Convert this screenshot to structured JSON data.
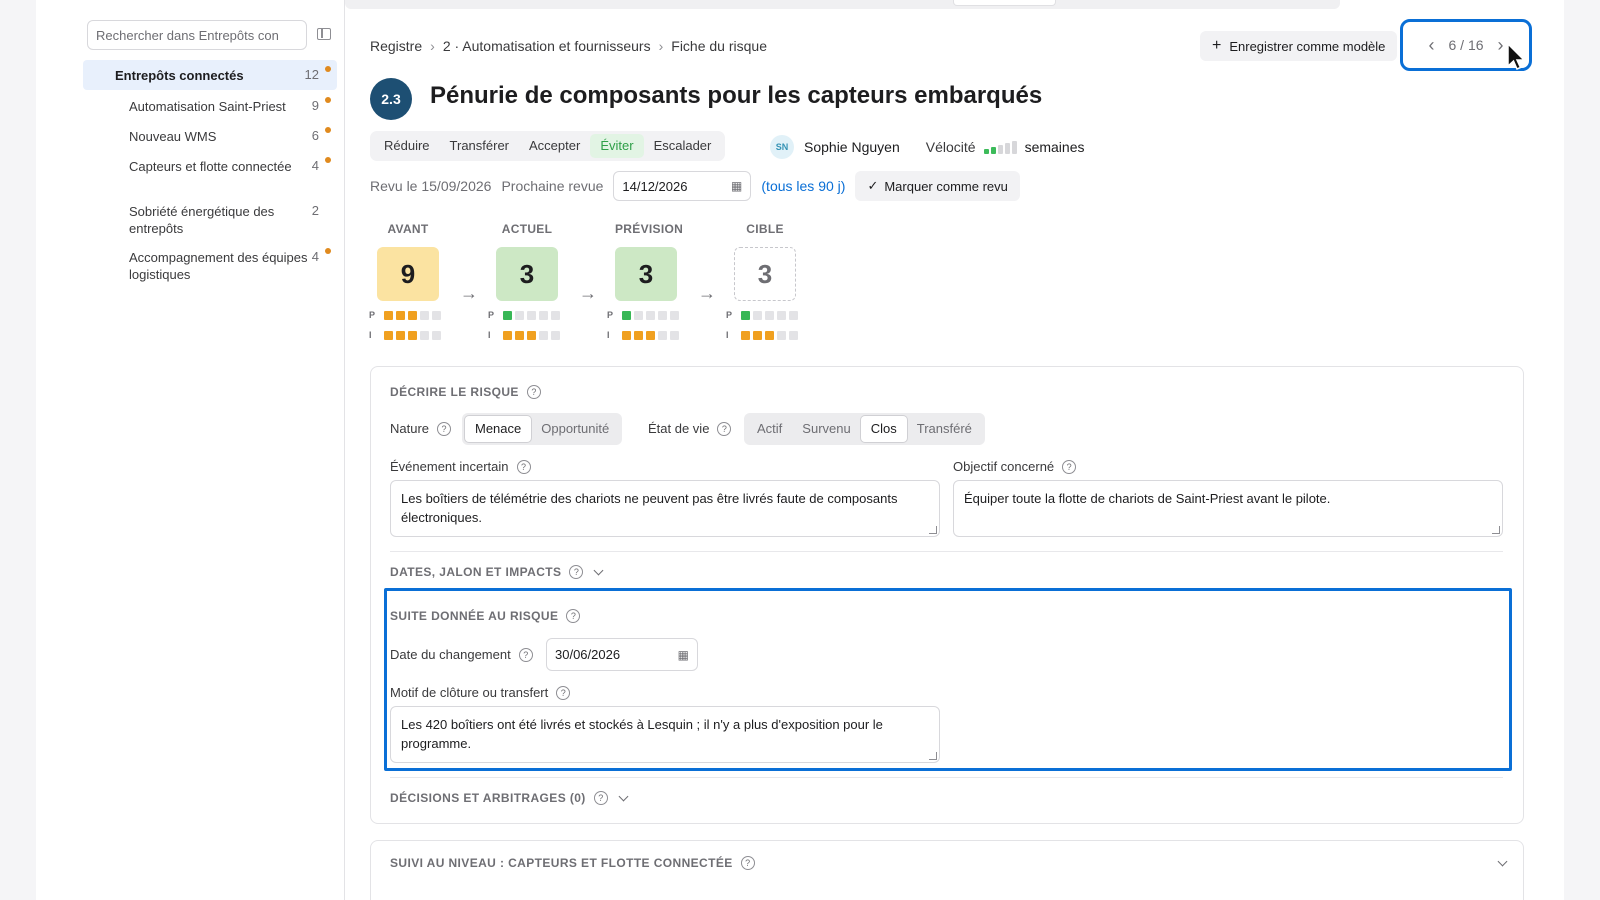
{
  "sidebar": {
    "search_placeholder": "Rechercher dans Entrepôts con",
    "items": [
      {
        "label": "Entrepôts connectés",
        "count": "12",
        "dot": true
      },
      {
        "label": "Automatisation Saint-Priest",
        "count": "9",
        "dot": true
      },
      {
        "label": "Nouveau WMS",
        "count": "6",
        "dot": true
      },
      {
        "label": "Capteurs et flotte connectée",
        "count": "4",
        "dot": true
      },
      {
        "label": "Sobriété énergétique des entrepôts",
        "count": "2",
        "dot": false
      },
      {
        "label": "Accompagnement des équipes logistiques",
        "count": "4",
        "dot": true
      }
    ]
  },
  "breadcrumb": [
    "Registre",
    "2 · Automatisation et fournisseurs",
    "Fiche du risque"
  ],
  "header": {
    "save_template_label": "Enregistrer comme modèle",
    "pager": "6 / 16",
    "badge": "2.3",
    "title": "Pénurie de composants pour les capteurs embarqués"
  },
  "responses": {
    "options": [
      "Réduire",
      "Transférer",
      "Accepter",
      "Éviter",
      "Escalader"
    ],
    "selected": "Éviter"
  },
  "owner": {
    "initials": "SN",
    "name": "Sophie Nguyen",
    "velocity_label": "Vélocité",
    "velocity_unit": "semaines",
    "velocity_level": 2,
    "velocity_max": 5
  },
  "review": {
    "reviewed": "Revu le 15/09/2026",
    "next_label": "Prochaine revue",
    "next_date": "14/12/2026",
    "frequency": "(tous les 90 j)",
    "mark_label": "Marquer comme revu"
  },
  "scores": [
    {
      "label": "AVANT",
      "value": "9",
      "p": 3,
      "i": 3,
      "color": "#fbe3a1"
    },
    {
      "label": "ACTUEL",
      "value": "3",
      "p": 1,
      "i": 3,
      "color": "#cde8c5"
    },
    {
      "label": "PRÉVISION",
      "value": "3",
      "p": 1,
      "i": 3,
      "color": "#cde8c5"
    },
    {
      "label": "CIBLE",
      "value": "3",
      "p": 1,
      "i": 3,
      "color": "#ffffff"
    }
  ],
  "pi_labels": {
    "p": "P",
    "i": "I"
  },
  "describe": {
    "title": "DÉCRIRE LE RISQUE",
    "nature_label": "Nature",
    "nature_options": [
      "Menace",
      "Opportunité"
    ],
    "nature_selected": "Menace",
    "state_label": "État de vie",
    "state_options": [
      "Actif",
      "Survenu",
      "Clos",
      "Transféré"
    ],
    "state_selected": "Clos",
    "event_label": "Événement incertain",
    "event_value": "Les boîtiers de télémétrie des chariots ne peuvent pas être livrés faute de composants électroniques.",
    "objective_label": "Objectif concerné",
    "objective_value": "Équiper toute la flotte de chariots de Saint-Priest avant le pilote."
  },
  "dates_section": "DATES, JALON ET IMPACTS",
  "followup": {
    "title": "SUITE DONNÉE AU RISQUE",
    "change_date_label": "Date du changement",
    "change_date": "30/06/2026",
    "reason_label": "Motif de clôture ou transfert",
    "reason_value": "Les 420 boîtiers ont été livrés et stockés à Lesquin ; il n'y a plus d'exposition pour le programme."
  },
  "decisions_section": "DÉCISIONS ET ARBITRAGES (0)",
  "level_section": "SUIVI AU NIVEAU : CAPTEURS ET FLOTTE CONNECTÉE"
}
